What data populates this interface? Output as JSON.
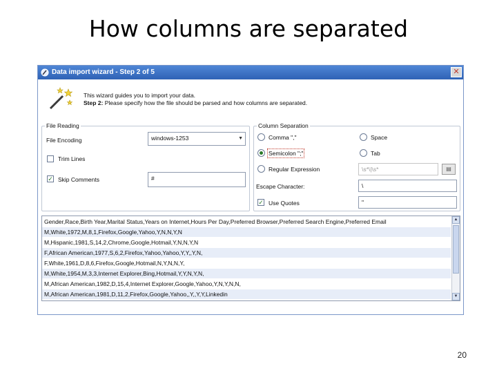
{
  "slide": {
    "title": "How columns are separated",
    "page_number": "20"
  },
  "window": {
    "title": "Data import wizard - Step 2 of 5",
    "close_label": "✕",
    "intro_line1": "This wizard guides you to import your data.",
    "intro_step": "Step 2:",
    "intro_line2": "Please specify how the file should be parsed and how columns are separated."
  },
  "file_reading": {
    "group_label": "File Reading",
    "encoding_label": "File Encoding",
    "encoding_value": "windows-1253",
    "trim_lines_label": "Trim Lines",
    "trim_lines_checked": false,
    "skip_comments_label": "Skip Comments",
    "skip_comments_checked": true,
    "comment_char": "#"
  },
  "column_separation": {
    "group_label": "Column Separation",
    "options": [
      {
        "label": "Comma \",\"",
        "checked": false
      },
      {
        "label": "Space",
        "checked": false
      },
      {
        "label": "Semicolon \";\"",
        "checked": true
      },
      {
        "label": "Tab",
        "checked": false
      },
      {
        "label": "Regular Expression",
        "checked": false
      }
    ],
    "regex_value": "\\s*\\|\\s*",
    "escape_label": "Escape Character:",
    "escape_value": "\\",
    "use_quotes_label": "Use Quotes",
    "use_quotes_checked": true,
    "quote_value": "\""
  },
  "preview": {
    "rows": [
      "Gender,Race,Birth Year,Marital Status,Years on Internet,Hours Per Day,Preferred Browser,Preferred Search Engine,Preferred Email",
      "M,White,1972,M,8,1,Firefox,Google,Yahoo,Y,N,N,Y,N",
      "M,Hispanic,1981,S,14,2,Chrome,Google,Hotmail,Y,N,N,Y,N",
      "F,African American,1977,S,6,2,Firefox,Yahoo,Yahoo,Y,Y,,Y,N,",
      "F,White,1961,D,8,6,Firefox,Google,Hotmail,N,Y,N,N,Y,",
      "M,White,1954,M,3,3,Internet Explorer,Bing,Hotmail,Y,Y,N,Y,N,",
      "M,African American,1982,D,15,4,Internet Explorer,Google,Yahoo,Y,N,Y,N,N,",
      "M,African American,1981,D,11,2,Firefox,Google,Yahoo,,Y,,Y,Y,Linkedin"
    ]
  },
  "icons": {
    "app": "wizard-app-icon",
    "wizard": "magic-wand-icon",
    "browse": "browse-icon"
  }
}
